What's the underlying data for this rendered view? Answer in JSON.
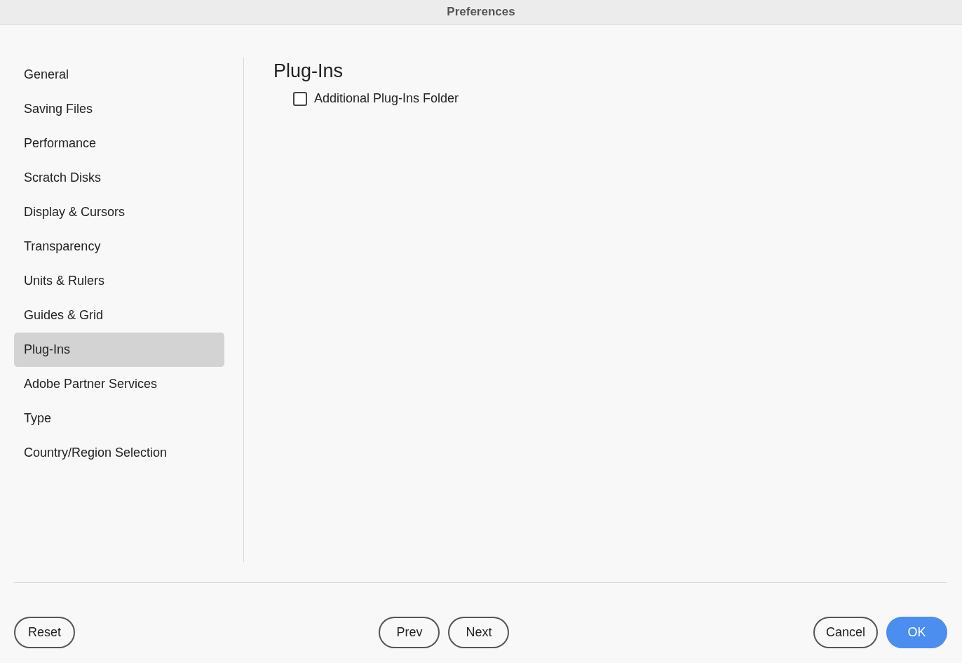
{
  "window": {
    "title": "Preferences"
  },
  "sidebar": {
    "items": [
      {
        "label": "General",
        "selected": false
      },
      {
        "label": "Saving Files",
        "selected": false
      },
      {
        "label": "Performance",
        "selected": false
      },
      {
        "label": "Scratch Disks",
        "selected": false
      },
      {
        "label": "Display & Cursors",
        "selected": false
      },
      {
        "label": "Transparency",
        "selected": false
      },
      {
        "label": "Units & Rulers",
        "selected": false
      },
      {
        "label": "Guides & Grid",
        "selected": false
      },
      {
        "label": "Plug-Ins",
        "selected": true
      },
      {
        "label": "Adobe Partner Services",
        "selected": false
      },
      {
        "label": "Type",
        "selected": false
      },
      {
        "label": "Country/Region Selection",
        "selected": false
      }
    ]
  },
  "panel": {
    "title": "Plug-Ins",
    "options": [
      {
        "label": "Additional Plug-Ins Folder",
        "checked": false
      }
    ]
  },
  "footer": {
    "left": [
      {
        "label": "Reset",
        "kind": "secondary"
      }
    ],
    "center": [
      {
        "label": "Prev",
        "kind": "secondary"
      },
      {
        "label": "Next",
        "kind": "secondary"
      }
    ],
    "right": [
      {
        "label": "Cancel",
        "kind": "secondary"
      },
      {
        "label": "OK",
        "kind": "primary"
      }
    ]
  }
}
